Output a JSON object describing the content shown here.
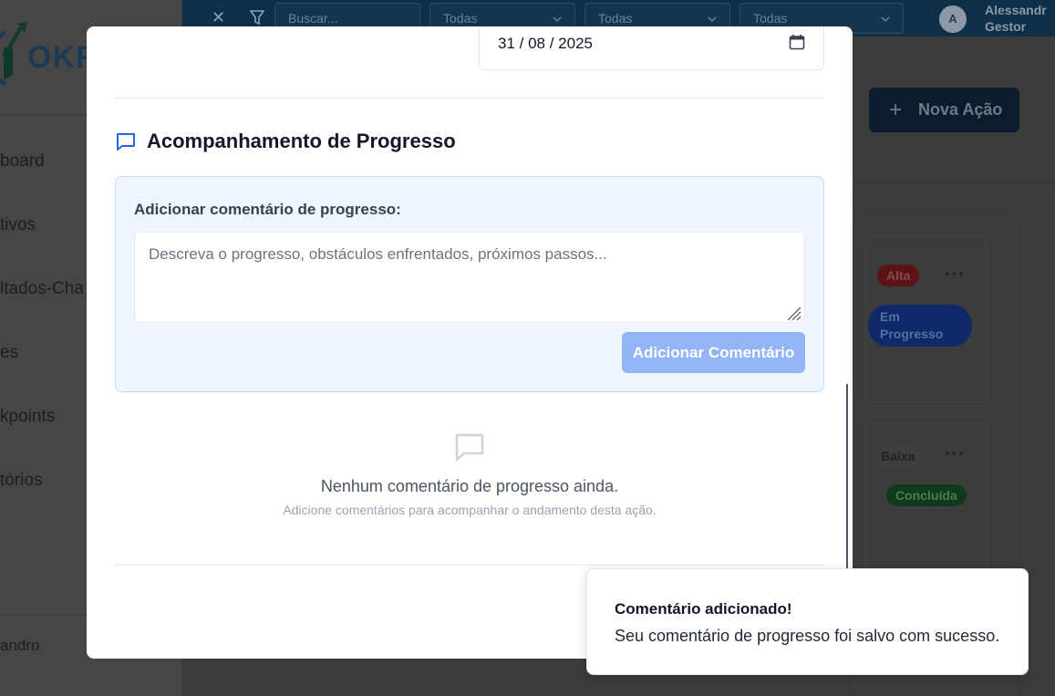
{
  "background": {
    "topbar": {
      "search_placeholder": "Buscar...",
      "filters": [
        "Todas",
        "Todas",
        "Todas"
      ],
      "avatar_initial": "A",
      "user_name": "Alessandr",
      "user_role": "Gestor"
    },
    "logo_text": "OKR",
    "sidebar_items": [
      "board",
      "tivos",
      "ltados-Cha",
      "es",
      "kpoints",
      "tórios"
    ],
    "sidebar_user": "andro",
    "new_action_label": "Nova Ação",
    "cards": [
      {
        "priority": "Alta",
        "status": "Em Progresso"
      },
      {
        "priority": "Baixa",
        "status": "Concluída"
      }
    ],
    "colors": {
      "topbar": "#0d2f4a",
      "primary_button": "#0c1b2d"
    }
  },
  "modal": {
    "date_value": "31 / 08 / 2025",
    "section_title": "Acompanhamento de Progresso",
    "comment_form": {
      "label": "Adicionar comentário de progresso:",
      "placeholder": "Descreva o progresso, obstáculos enfrentados, próximos passos...",
      "value": "",
      "submit_label": "Adicionar Comentário"
    },
    "empty_state": {
      "title": "Nenhum comentário de progresso ainda.",
      "subtitle": "Adicione comentários para acompanhar o andamento desta ação."
    },
    "colors": {
      "accent": "#2563eb",
      "form_bg": "#eff6ff",
      "button_disabled": "#93b4f5"
    }
  },
  "toast": {
    "title": "Comentário adicionado!",
    "description": "Seu comentário de progresso foi salvo com sucesso."
  }
}
